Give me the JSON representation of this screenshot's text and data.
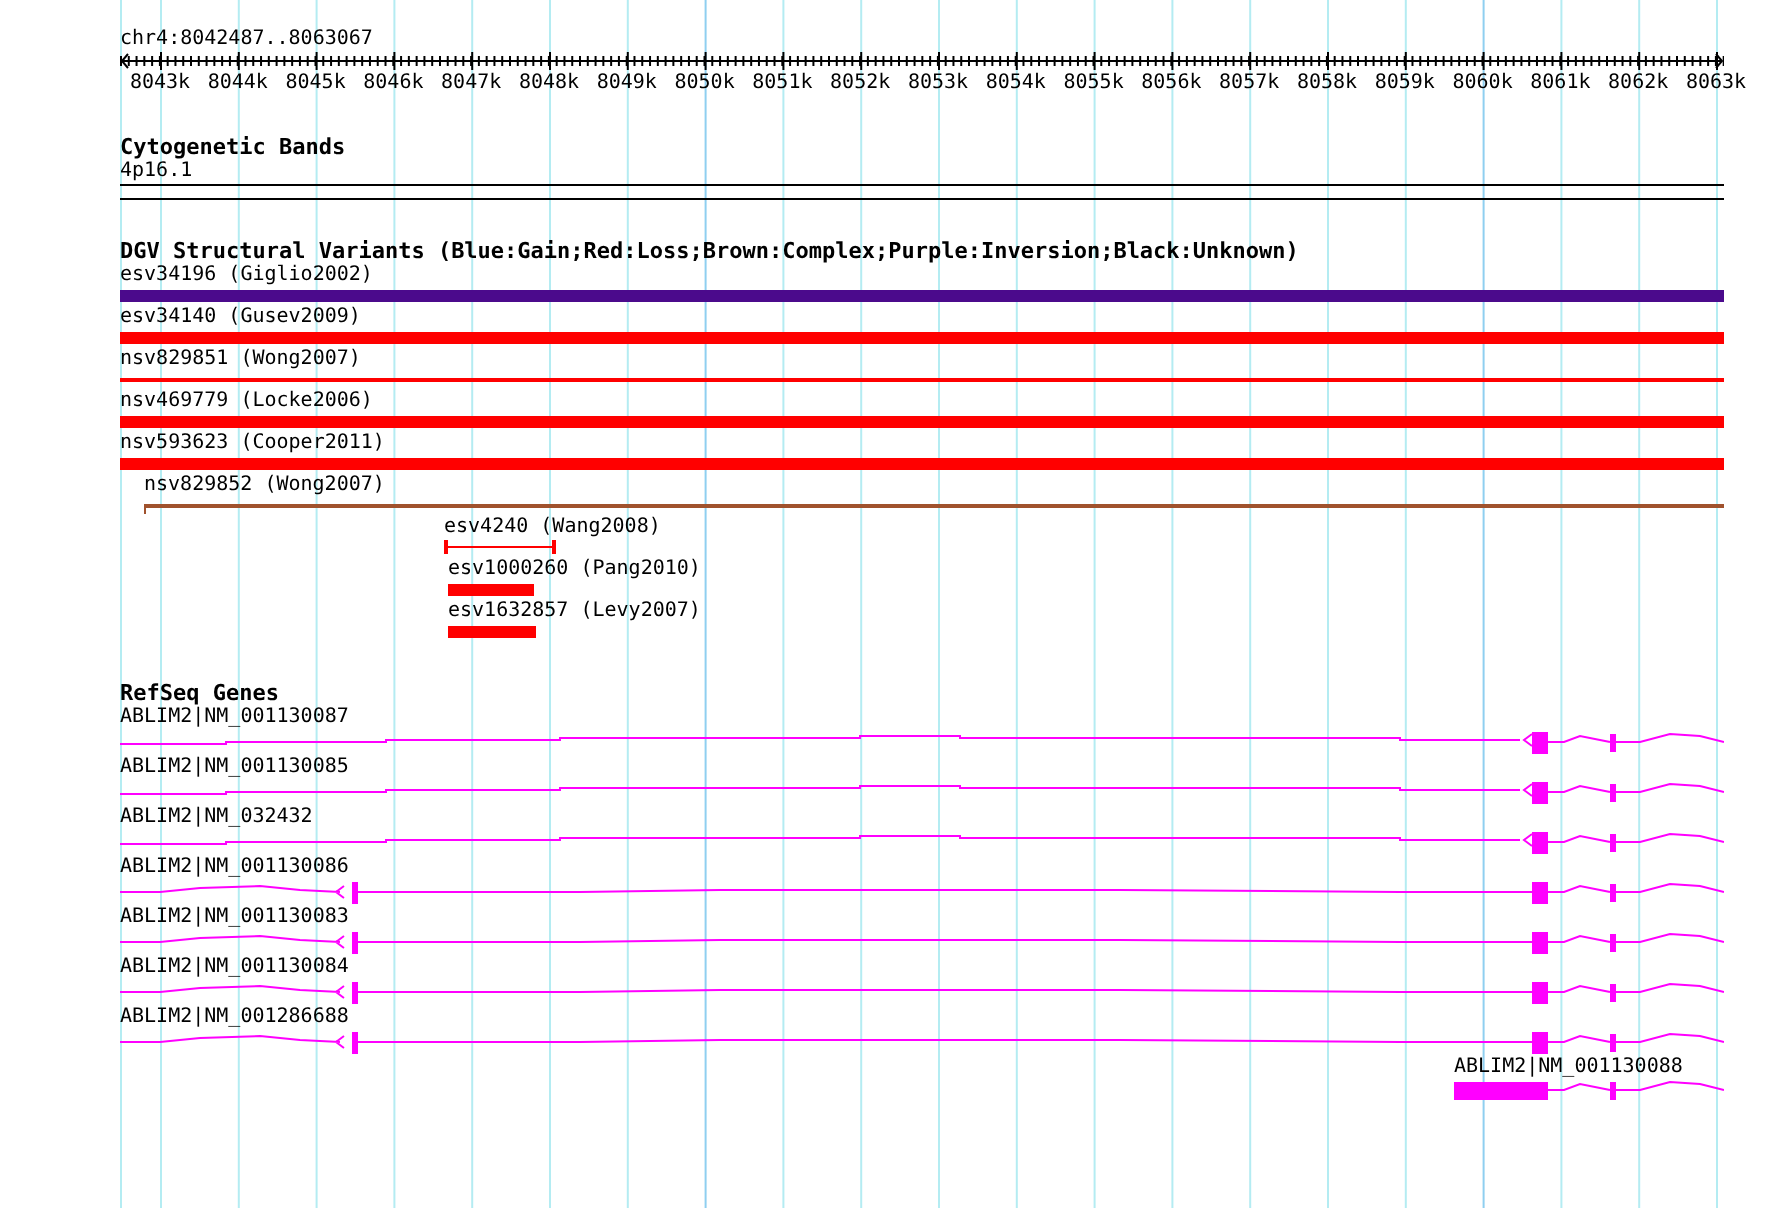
{
  "ruler": {
    "position": "chr4:8042487..8063067",
    "ticks": [
      "8043k",
      "8044k",
      "8045k",
      "8046k",
      "8047k",
      "8048k",
      "8049k",
      "8050k",
      "8051k",
      "8052k",
      "8053k",
      "8054k",
      "8055k",
      "8056k",
      "8057k",
      "8058k",
      "8059k",
      "8060k",
      "8061k",
      "8062k",
      "8063k"
    ]
  },
  "cytogenetic_bands": {
    "title": "Cytogenetic Bands",
    "band": "4p16.1"
  },
  "dgv_variants": {
    "title": "DGV Structural Variants (Blue:Gain;Red:Loss;Brown:Complex;Purple:Inversion;Black:Unknown)",
    "items": [
      {
        "label": "esv34196 (Giglio2002)",
        "kind": "bar",
        "color": "#4b0a8c"
      },
      {
        "label": "esv34140 (Gusev2009)",
        "kind": "bar",
        "color": "#ff0000"
      },
      {
        "label": "nsv829851 (Wong2007)",
        "kind": "line",
        "color": "#ff0000"
      },
      {
        "label": "nsv469779 (Locke2006)",
        "kind": "bar",
        "color": "#ff0000"
      },
      {
        "label": "nsv593623 (Cooper2011)",
        "kind": "bar",
        "color": "#ff0000"
      },
      {
        "label": "nsv829852 (Wong2007)",
        "kind": "line",
        "color": "#a0522d"
      },
      {
        "label": "esv4240 (Wang2008)",
        "kind": "span",
        "color": "#ff0000"
      },
      {
        "label": "esv1000260 (Pang2010)",
        "kind": "bar",
        "color": "#ff0000"
      },
      {
        "label": "esv1632857 (Levy2007)",
        "kind": "bar",
        "color": "#ff0000"
      }
    ]
  },
  "refseq_genes": {
    "title": "RefSeq Genes",
    "items": [
      {
        "label": "ABLIM2|NM_001130087",
        "kind": "long"
      },
      {
        "label": "ABLIM2|NM_001130085",
        "kind": "long"
      },
      {
        "label": "ABLIM2|NM_032432",
        "kind": "long"
      },
      {
        "label": "ABLIM2|NM_001130086",
        "kind": "full"
      },
      {
        "label": "ABLIM2|NM_001130083",
        "kind": "full"
      },
      {
        "label": "ABLIM2|NM_001130084",
        "kind": "full"
      },
      {
        "label": "ABLIM2|NM_001286688",
        "kind": "full"
      },
      {
        "label": "ABLIM2|NM_001130088",
        "kind": "short"
      }
    ]
  }
}
